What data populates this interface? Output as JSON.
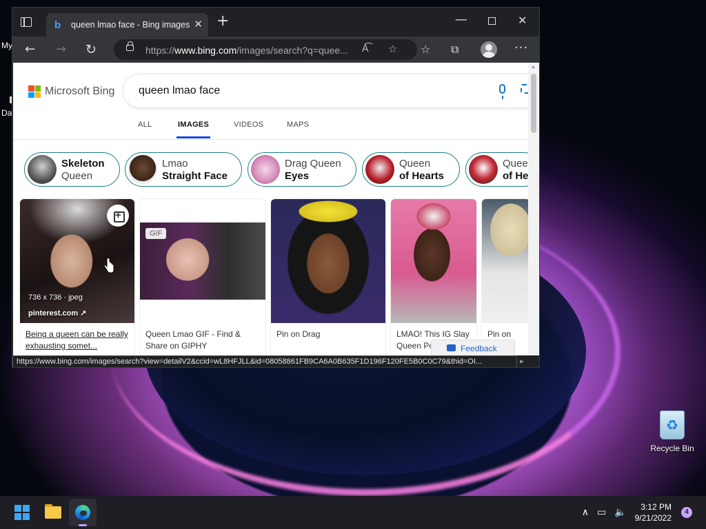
{
  "desktop": {
    "icon_top_label": "My",
    "icon_mid_label": "Da",
    "recycle_bin_label": "Recycle Bin"
  },
  "taskbar": {
    "time": "3:12 PM",
    "date": "9/21/2022",
    "notification_count": "4"
  },
  "browser": {
    "tab_title": "queen lmao face - Bing images",
    "address": {
      "prefix": "https://",
      "host": "www.bing.com",
      "path": "/images/search?q=quee..."
    },
    "status_url": "https://www.bing.com/images/search?view=detailV2&ccid=wL8HFJLL&id=08058861FB9CA6A0B635F1D196F120FE5B0C0C79&thid=OI..."
  },
  "bing": {
    "brand": "Microsoft Bing",
    "query": "queen lmao face",
    "nav_tabs": [
      "ALL",
      "IMAGES",
      "VIDEOS",
      "MAPS"
    ],
    "chips": [
      {
        "line1": "Skeleton",
        "line2": "Queen"
      },
      {
        "line1": "Lmao",
        "line2": "Straight Face"
      },
      {
        "line1": "Drag Queen",
        "line2": "Eyes"
      },
      {
        "line1": "Queen",
        "line2": "of Hearts"
      },
      {
        "line1": "Quee",
        "line2": "of He"
      }
    ],
    "results": [
      {
        "title": "Being a queen can be really exhausting somet...",
        "dimensions": "736 x 736 · jpeg",
        "source": "pinterest.com"
      },
      {
        "title": "Queen Lmao GIF - Find & Share on GIPHY",
        "badge": "GIF"
      },
      {
        "title": "Pin on Drag"
      },
      {
        "title": "LMAO! This IG Slay Queen Po..."
      },
      {
        "title": "Pin on DRA"
      }
    ],
    "feedback_label": "Feedback"
  },
  "colors": {
    "accent": "#174ae4",
    "chip_border": "#1a7f83",
    "taskbar": "#1e1e24"
  }
}
